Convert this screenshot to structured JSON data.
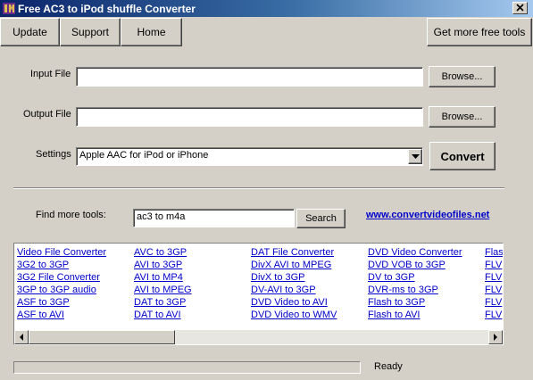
{
  "window": {
    "title": "Free AC3 to iPod shuffle Converter"
  },
  "toolbar": {
    "update": "Update",
    "support": "Support",
    "home": "Home",
    "more_tools": "Get more free tools"
  },
  "form": {
    "input_label": "Input File",
    "input_value": "",
    "output_label": "Output File",
    "output_value": "",
    "browse": "Browse...",
    "settings_label": "Settings",
    "settings_value": "Apple AAC for iPod or iPhone",
    "convert": "Convert"
  },
  "find": {
    "label": "Find more tools:",
    "query": "ac3 to m4a",
    "search": "Search",
    "site_link": "www.convertvideofiles.net"
  },
  "tools": {
    "col1": [
      "Video File Converter",
      "3G2 to 3GP",
      "3G2 File Converter",
      "3GP to 3GP audio",
      "ASF to 3GP",
      "ASF to AVI"
    ],
    "col2": [
      "AVC to 3GP",
      "AVI to 3GP",
      "AVI to MP4",
      "AVI to MPEG",
      "DAT to 3GP",
      "DAT to AVI"
    ],
    "col3": [
      "DAT File Converter",
      "DivX AVI to MPEG",
      "DivX to 3GP",
      "DV-AVI to 3GP",
      "DVD Video to AVI",
      "DVD Video to WMV"
    ],
    "col4": [
      "DVD Video Converter",
      "DVD VOB to 3GP",
      "DV to 3GP",
      "DVR-ms to 3GP",
      "Flash to 3GP",
      "Flash to AVI"
    ],
    "col5": [
      "Flash",
      "FLV",
      "FLV",
      "FLV",
      "FLV",
      "FLV"
    ]
  },
  "status": {
    "text": "Ready",
    "progress": 0
  }
}
